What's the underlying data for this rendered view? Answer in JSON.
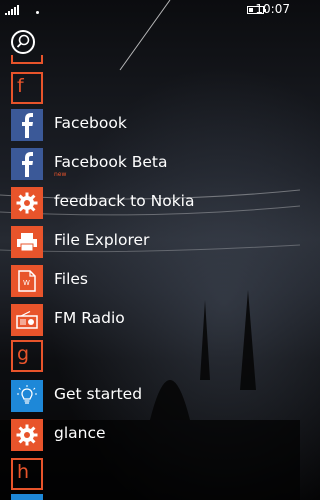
{
  "status": {
    "time": "10:07",
    "battery_fraction": 0.3,
    "signal_bars": 5
  },
  "search": {
    "icon": "search-icon"
  },
  "sections": [
    {
      "letter": "f"
    },
    {
      "letter": "g"
    },
    {
      "letter": "h"
    }
  ],
  "apps": [
    {
      "label": "Facebook",
      "icon": "facebook-icon",
      "tile_color": "#3b5998"
    },
    {
      "label": "Facebook Beta",
      "sublabel": "new",
      "icon": "facebook-icon",
      "tile_color": "#3b5998"
    },
    {
      "label": "feedback to Nokia",
      "icon": "gear-icon",
      "tile_color": "#e8542b"
    },
    {
      "label": "File Explorer",
      "icon": "printer-icon",
      "tile_color": "#e8542b"
    },
    {
      "label": "Files",
      "icon": "document-icon",
      "tile_color": "#e8542b"
    },
    {
      "label": "FM Radio",
      "icon": "radio-icon",
      "tile_color": "#e8542b"
    },
    {
      "label": "Get started",
      "icon": "lightbulb-icon",
      "tile_color": "#1e88d8"
    },
    {
      "label": "glance",
      "icon": "gear-icon",
      "tile_color": "#e8542b"
    }
  ],
  "colors": {
    "accent": "#e8542b",
    "facebook": "#3b5998",
    "blue": "#1e88d8"
  }
}
